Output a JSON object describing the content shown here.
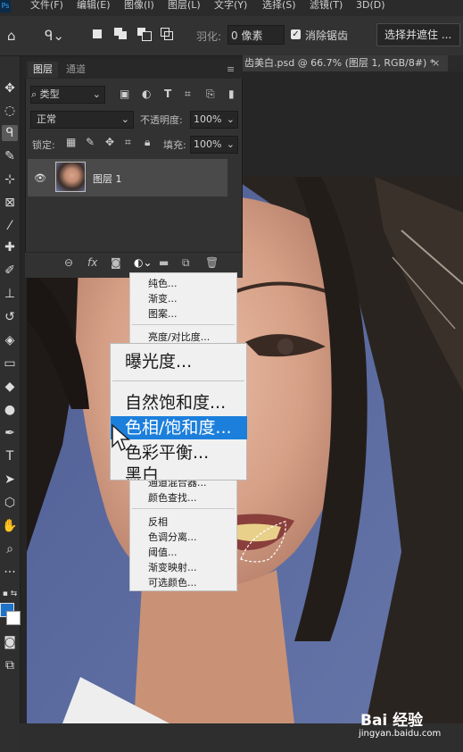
{
  "menubar": {
    "logo": "Ps",
    "items": [
      "文件(F)",
      "编辑(E)",
      "图像(I)",
      "图层(L)",
      "文字(Y)",
      "选择(S)",
      "滤镜(T)",
      "3D(D)"
    ]
  },
  "options": {
    "feather_label": "羽化:",
    "feather_value": "0 像素",
    "antialias_label": "消除锯齿",
    "select_mask_label": "选择并遮住 ..."
  },
  "document_tab": {
    "title": "齿美白.psd @ 66.7% (图层 1, RGB/8#) *",
    "close": "×"
  },
  "layers_panel": {
    "tab_layers": "图层",
    "tab_channels": "通道",
    "filter_kind": "类型",
    "blend_mode": "正常",
    "opacity_label": "不透明度:",
    "opacity_value": "100%",
    "lock_label": "锁定:",
    "fill_label": "填充:",
    "fill_value": "100%",
    "layers": [
      {
        "name": "图层 1",
        "visible": true
      }
    ]
  },
  "adjust_menu": {
    "items": [
      "纯色...",
      "渐变...",
      "图案...",
      "亮度/对比度...",
      "曝光度...",
      "自然饱和度...",
      "色相/饱和度...",
      "色彩平衡...",
      "黑白...",
      "通道混合器...",
      "颜色查找...",
      "反相",
      "色调分离...",
      "阈值...",
      "渐变映射...",
      "可选颜色..."
    ],
    "highlighted": "色相/饱和度..."
  },
  "zoom_overlay": {
    "items": [
      "曝光度...",
      "自然饱和度...",
      "色相/饱和度...",
      "色彩平衡...",
      "黑白"
    ],
    "highlighted_color": "#1c7fdc"
  },
  "watermark": {
    "logo": "Bai 经验",
    "url": "jingyan.baidu.com"
  },
  "colors": {
    "foreground": "#1e73c8",
    "background": "#ffffff"
  }
}
